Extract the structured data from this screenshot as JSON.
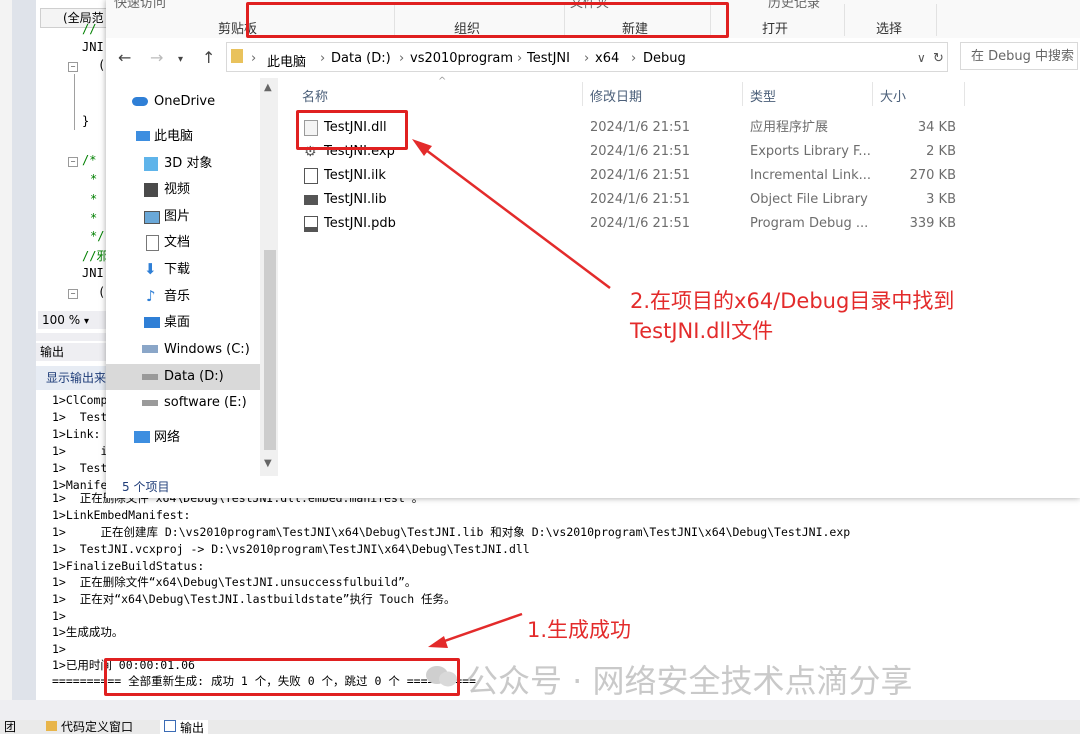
{
  "vs": {
    "scope": "(全局范",
    "code_lines": [
      "//",
      "JNI",
      "(",
      "}",
      "/*",
      "*",
      "*",
      "*",
      "*/",
      "//邪",
      "JNI",
      "("
    ],
    "zoom": "100 %",
    "output_title": "输出",
    "output_show": "显示输出来",
    "output_lines": [
      "1>ClComp",
      "1>  Test",
      "1>Link:",
      "1>     i",
      "1>  Test",
      "1>Manife",
      "1>  正在删除文件“x64\\Debug\\TestJNI.dll.embed.manifest”。",
      "1>LinkEmbedManifest:",
      "1>     正在创建库 D:\\vs2010program\\TestJNI\\x64\\Debug\\TestJNI.lib 和对象 D:\\vs2010program\\TestJNI\\x64\\Debug\\TestJNI.exp",
      "1>  TestJNI.vcxproj -> D:\\vs2010program\\TestJNI\\x64\\Debug\\TestJNI.dll",
      "1>FinalizeBuildStatus:",
      "1>  正在删除文件“x64\\Debug\\TestJNI.unsuccessfulbuild”。",
      "1>  正在对“x64\\Debug\\TestJNI.lastbuildstate”执行 Touch 任务。",
      "1>",
      "1>生成成功。",
      "1>",
      "1>已用时间 00:00:01.06",
      "========== 全部重新生成: 成功 1 个，失败 0 个，跳过 0 个 =========="
    ],
    "bottom_tabs": [
      "团",
      "代码定义窗口",
      "输出"
    ]
  },
  "explorer": {
    "ribbon_top": [
      "快速访问",
      "文件夹",
      "历史记录"
    ],
    "ribbon_groups": [
      "剪贴板",
      "组织",
      "新建",
      "打开",
      "选择"
    ],
    "breadcrumbs": [
      "此电脑",
      "Data (D:)",
      "vs2010program",
      "TestJNI",
      "x64",
      "Debug"
    ],
    "search_placeholder": "在 Debug 中搜索",
    "sidebar": [
      {
        "label": "OneDrive",
        "icon": "cloud-icon"
      },
      {
        "label": "此电脑",
        "icon": "computer-icon"
      },
      {
        "label": "3D 对象",
        "icon": "cube-icon"
      },
      {
        "label": "视频",
        "icon": "video-icon"
      },
      {
        "label": "图片",
        "icon": "picture-icon"
      },
      {
        "label": "文档",
        "icon": "document-icon"
      },
      {
        "label": "下载",
        "icon": "download-icon"
      },
      {
        "label": "音乐",
        "icon": "music-icon"
      },
      {
        "label": "桌面",
        "icon": "desktop-icon"
      },
      {
        "label": "Windows (C:)",
        "icon": "drive-icon"
      },
      {
        "label": "Data (D:)",
        "icon": "drive-icon"
      },
      {
        "label": "software (E:)",
        "icon": "drive-icon"
      },
      {
        "label": "网络",
        "icon": "network-icon"
      }
    ],
    "columns": [
      "名称",
      "修改日期",
      "类型",
      "大小"
    ],
    "files": [
      {
        "name": "TestJNI.dll",
        "date": "2024/1/6 21:51",
        "type": "应用程序扩展",
        "size": "34 KB",
        "icon": "dll-file-icon"
      },
      {
        "name": "TestJNI.exp",
        "date": "2024/1/6 21:51",
        "type": "Exports Library F...",
        "size": "2 KB",
        "icon": "exp-file-icon"
      },
      {
        "name": "TestJNI.ilk",
        "date": "2024/1/6 21:51",
        "type": "Incremental Link...",
        "size": "270 KB",
        "icon": "ilk-file-icon"
      },
      {
        "name": "TestJNI.lib",
        "date": "2024/1/6 21:51",
        "type": "Object File Library",
        "size": "3 KB",
        "icon": "lib-file-icon"
      },
      {
        "name": "TestJNI.pdb",
        "date": "2024/1/6 21:51",
        "type": "Program Debug ...",
        "size": "339 KB",
        "icon": "pdb-file-icon"
      }
    ],
    "status": "5 个项目"
  },
  "annotations": {
    "step2_line1": "2.在项目的x64/Debug目录中找到",
    "step2_line2": "TestJNI.dll文件",
    "step1": "1.生成成功",
    "watermark": "公众号 · 网络安全技术点滴分享",
    "color": "#e32b2b"
  }
}
